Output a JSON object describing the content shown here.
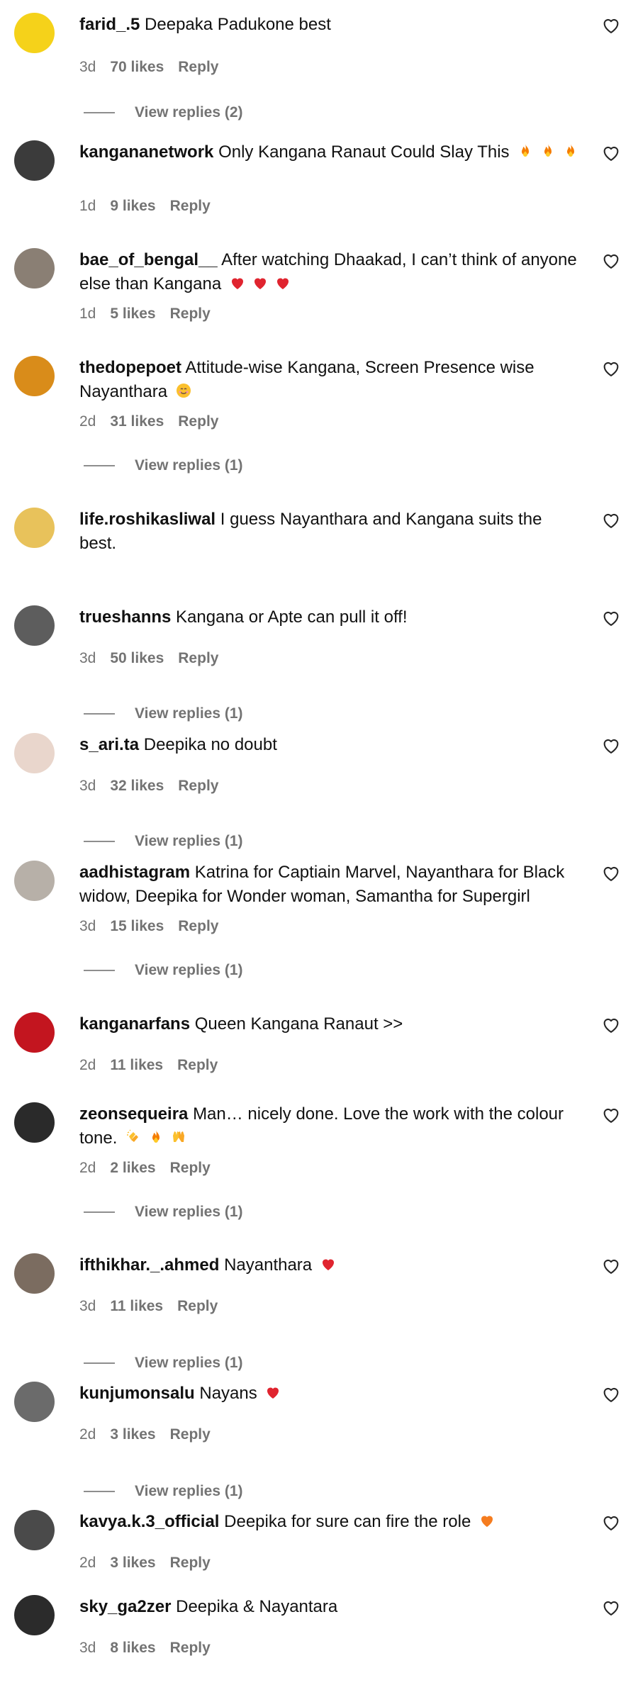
{
  "comments": [
    {
      "username": "farid_.5",
      "text": "Deepaka Padukone best",
      "time": "3d",
      "likes": "70 likes",
      "reply": "Reply",
      "replies": "View replies (2)",
      "avatar": "#f5d21a"
    },
    {
      "username": "kangananetwork",
      "text": "Only Kangana Ranaut Could Slay This",
      "emoji": [
        "fire",
        "fire",
        "fire"
      ],
      "time": "1d",
      "likes": "9 likes",
      "reply": "Reply",
      "replies": "",
      "avatar": "#3b3b3b"
    },
    {
      "username": "bae_of_bengal__",
      "text": "After watching Dhaakad, I can’t think of anyone else than Kangana",
      "emoji": [
        "heart",
        "heart",
        "heart"
      ],
      "time": "1d",
      "likes": "5 likes",
      "reply": "Reply",
      "replies": "",
      "avatar": "#8a7f74"
    },
    {
      "username": "thedopepoet",
      "text": "Attitude-wise Kangana, Screen Presence wise Nayanthara",
      "emoji": [
        "smile"
      ],
      "time": "2d",
      "likes": "31 likes",
      "reply": "Reply",
      "replies": "View replies (1)",
      "avatar": "#d98c1a"
    },
    {
      "username": "life.roshikasliwal",
      "text": "I guess Nayanthara and Kangana suits the best.",
      "time": "",
      "likes": "",
      "reply": "",
      "replies": "",
      "avatar": "#e8c25b"
    },
    {
      "username": "trueshanns",
      "text": "Kangana or Apte can pull it off!",
      "time": "3d",
      "likes": "50 likes",
      "reply": "Reply",
      "replies": "View replies (1)",
      "avatar": "#5d5d5d"
    },
    {
      "username": "s_ari.ta",
      "text": "Deepika no doubt",
      "time": "3d",
      "likes": "32 likes",
      "reply": "Reply",
      "replies": "View replies (1)",
      "avatar": "#e9d6cc"
    },
    {
      "username": "aadhistagram",
      "text": "Katrina for Captiain Marvel, Nayanthara for Black widow, Deepika for Wonder woman, Samantha for Supergirl",
      "time": "3d",
      "likes": "15 likes",
      "reply": "Reply",
      "replies": "View replies (1)",
      "avatar": "#b7b0a8"
    },
    {
      "username": "kanganarfans",
      "text": "Queen Kangana Ranaut >>",
      "time": "2d",
      "likes": "11 likes",
      "reply": "Reply",
      "replies": "",
      "avatar": "#c3151f"
    },
    {
      "username": "zeonsequeira",
      "text": "Man… nicely done. Love the work with the colour tone.",
      "emoji": [
        "clap",
        "fire",
        "raise"
      ],
      "time": "2d",
      "likes": "2 likes",
      "reply": "Reply",
      "replies": "View replies (1)",
      "avatar": "#2a2a2a"
    },
    {
      "username": "ifthikhar._.ahmed",
      "text": "Nayanthara",
      "emoji": [
        "heart"
      ],
      "time": "3d",
      "likes": "11 likes",
      "reply": "Reply",
      "replies": "View replies (1)",
      "avatar": "#7b6c60"
    },
    {
      "username": "kunjumonsalu",
      "text": "Nayans",
      "emoji": [
        "heart"
      ],
      "time": "2d",
      "likes": "3 likes",
      "reply": "Reply",
      "replies": "View replies (1)",
      "avatar": "#6b6b6b"
    },
    {
      "username": "kavya.k.3_official",
      "text": "Deepika for sure can fire the role",
      "emoji": [
        "orangeheart"
      ],
      "time": "2d",
      "likes": "3 likes",
      "reply": "Reply",
      "replies": "",
      "avatar": "#4a4a4a"
    },
    {
      "username": "sky_ga2zer",
      "text": "Deepika & Nayantara",
      "time": "3d",
      "likes": "8 likes",
      "reply": "Reply",
      "replies": "",
      "avatar": "#2b2b2b"
    }
  ],
  "icons": {
    "like": "heart-outline-icon"
  }
}
